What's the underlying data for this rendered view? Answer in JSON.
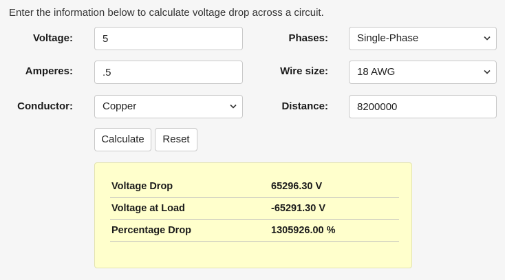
{
  "intro": "Enter the information below to calculate voltage drop across a circuit.",
  "form": {
    "voltage": {
      "label": "Voltage:",
      "value": "5"
    },
    "amperes": {
      "label": "Amperes:",
      "value": ".5"
    },
    "conductor": {
      "label": "Conductor:",
      "selected": "Copper"
    },
    "phases": {
      "label": "Phases:",
      "selected": "Single-Phase"
    },
    "wire_size": {
      "label": "Wire size:",
      "selected": "18 AWG"
    },
    "distance": {
      "label": "Distance:",
      "value": "8200000"
    }
  },
  "buttons": {
    "calculate": "Calculate",
    "reset": "Reset"
  },
  "results": {
    "rows": [
      {
        "label": "Voltage Drop",
        "value": "65296.30 V"
      },
      {
        "label": "Voltage at Load",
        "value": "-65291.30 V"
      },
      {
        "label": "Percentage Drop",
        "value": "1305926.00 %"
      }
    ],
    "background_color": "#ffffcc"
  },
  "icons": {
    "select_arrow": "chevron-down-icon"
  }
}
